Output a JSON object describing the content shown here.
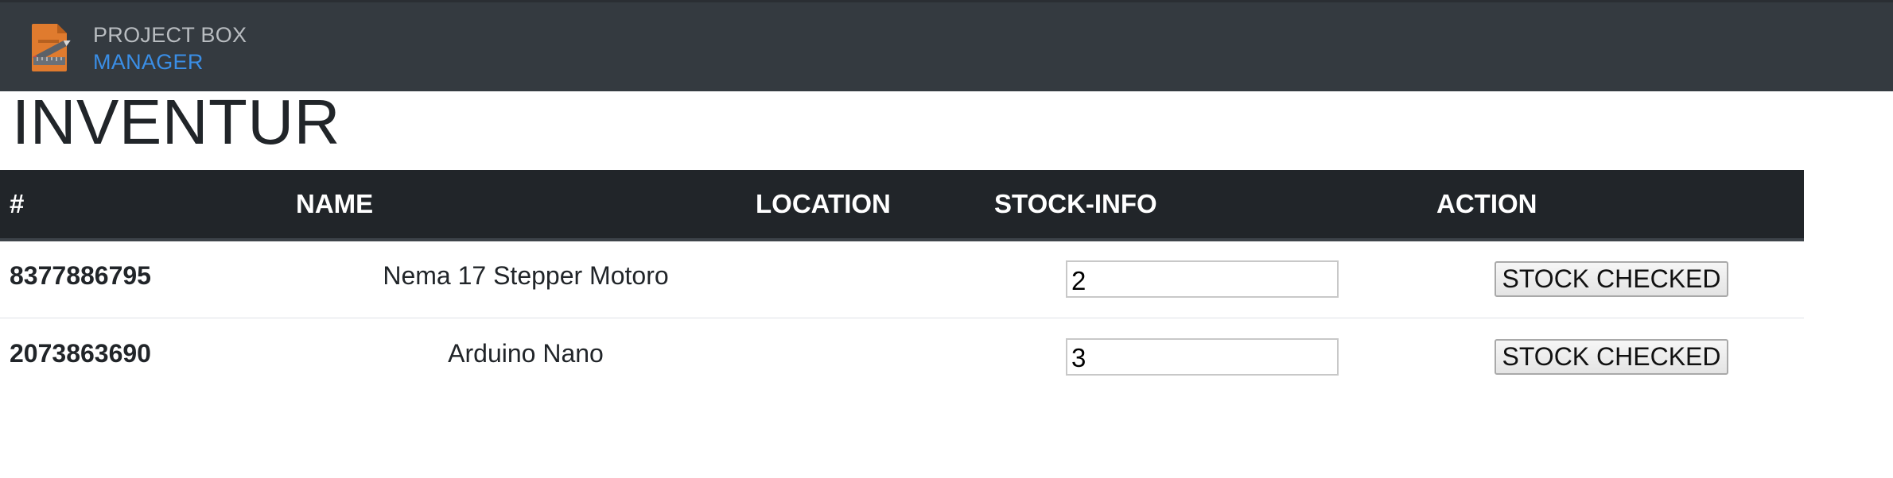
{
  "brand": {
    "line1": "PROJECT BOX",
    "line2": "MANAGER",
    "logo_icon": "document-pencil-icon",
    "logo_color": "#e07b2e"
  },
  "page": {
    "title": "INVENTUR"
  },
  "table": {
    "headers": {
      "id": "#",
      "name": "NAME",
      "location": "LOCATION",
      "stock": "STOCK-INFO",
      "action": "ACTION"
    },
    "rows": [
      {
        "id": "8377886795",
        "name": "Nema 17 Stepper Motoro",
        "location": "",
        "stock_value": "2",
        "action_label": "STOCK CHECKED"
      },
      {
        "id": "2073863690",
        "name": "Arduino Nano",
        "location": "",
        "stock_value": "3",
        "action_label": "STOCK CHECKED"
      }
    ]
  },
  "colors": {
    "navbar_bg": "#343a40",
    "table_header_bg": "#212529",
    "brand_accent": "#3a8ee6"
  }
}
